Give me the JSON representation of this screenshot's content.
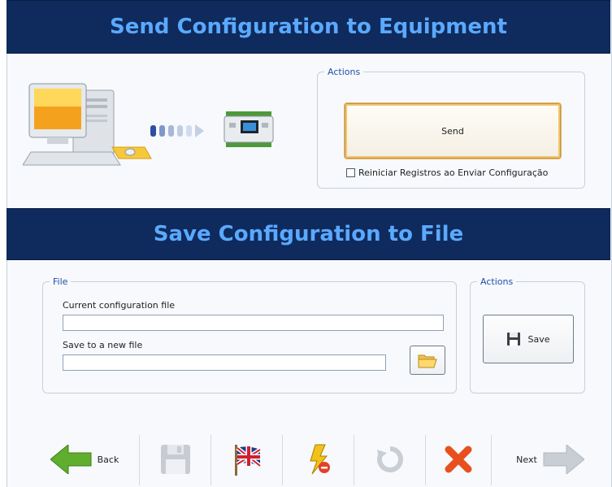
{
  "send_section": {
    "title": "Send Configuration to Equipment",
    "actions_legend": "Actions",
    "send_label": "Send",
    "reset_checkbox_label": "Reiniciar Registros ao Enviar Configuração",
    "reset_checked": false
  },
  "save_section": {
    "title": "Save Configuration to File",
    "file_legend": "File",
    "current_file_label": "Current configuration file",
    "current_file_value": "",
    "new_file_label": "Save to a new file",
    "new_file_value": "",
    "actions_legend": "Actions",
    "save_label": "Save"
  },
  "toolbar": {
    "back_label": "Back",
    "next_label": "Next"
  },
  "colors": {
    "banner_bg": "#0f2a5c",
    "banner_text": "#5aa9ff",
    "legend_text": "#1f4fa8",
    "back_arrow": "#5fae2e",
    "delete_x": "#e8501e"
  }
}
